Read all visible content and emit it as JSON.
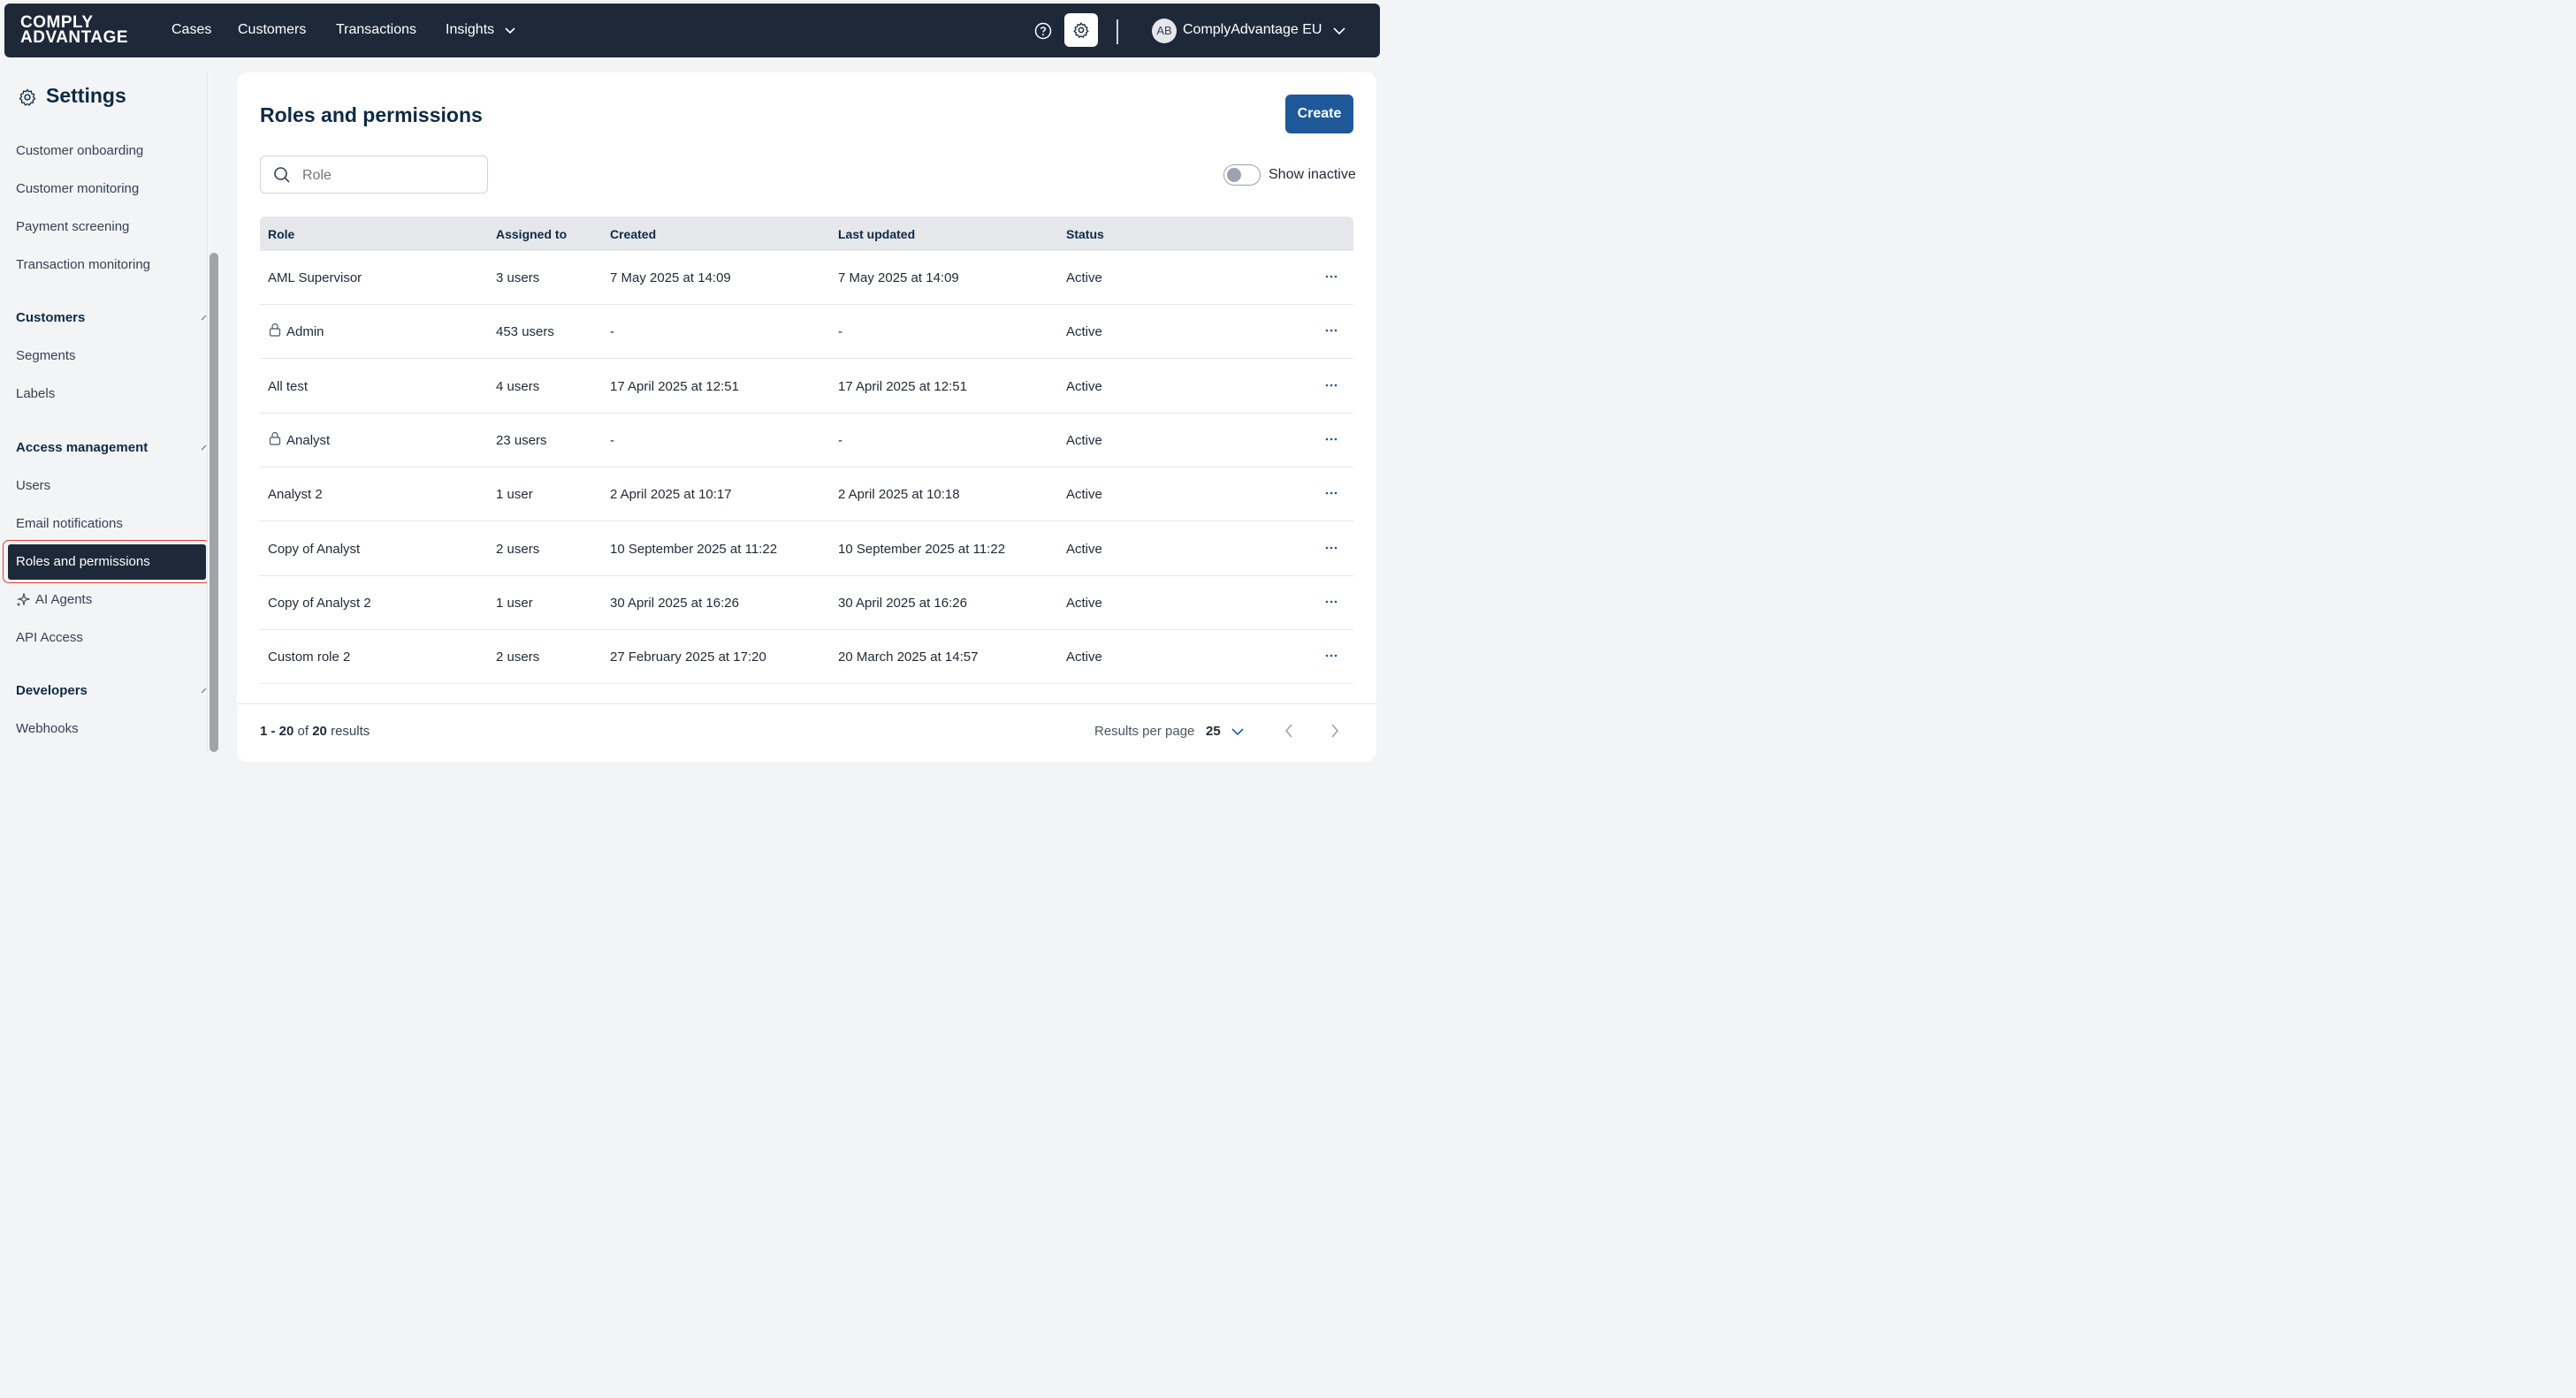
{
  "topbar": {
    "logo_line1": "COMPLY",
    "logo_line2": "ADVANTAGE",
    "nav": [
      "Cases",
      "Customers",
      "Transactions",
      "Insights"
    ],
    "account_initials": "AB",
    "account_name": "ComplyAdvantage EU",
    "icons": [
      "help-icon",
      "gear-icon",
      "chevron-down-icon"
    ]
  },
  "sidebar": {
    "title": "Settings",
    "items_top": [
      "Customer onboarding",
      "Customer monitoring",
      "Payment screening",
      "Transaction monitoring"
    ],
    "customers_heading": "Customers",
    "customers_items": [
      "Segments",
      "Labels"
    ],
    "access_heading": "Access management",
    "access_items": [
      "Users",
      "Email notifications",
      "Roles and permissions",
      "AI Agents",
      "API Access"
    ],
    "developers_heading": "Developers",
    "developers_items": [
      "Webhooks"
    ],
    "active_item": "Roles and permissions"
  },
  "main": {
    "title": "Roles and permissions",
    "create_label": "Create",
    "search_placeholder": "Role",
    "show_inactive_label": "Show inactive",
    "columns": [
      "Role",
      "Assigned to",
      "Created",
      "Last updated",
      "Status"
    ],
    "rows": [
      {
        "role": "AML Supervisor",
        "locked": false,
        "assigned": "3 users",
        "created": "7 May 2025 at 14:09",
        "updated": "7 May 2025 at 14:09",
        "status": "Active"
      },
      {
        "role": "Admin",
        "locked": true,
        "assigned": "453 users",
        "created": "-",
        "updated": "-",
        "status": "Active"
      },
      {
        "role": "All test",
        "locked": false,
        "assigned": "4 users",
        "created": "17 April 2025 at 12:51",
        "updated": "17 April 2025 at 12:51",
        "status": "Active"
      },
      {
        "role": "Analyst",
        "locked": true,
        "assigned": "23 users",
        "created": "-",
        "updated": "-",
        "status": "Active"
      },
      {
        "role": "Analyst 2",
        "locked": false,
        "assigned": "1 user",
        "created": "2 April 2025 at 10:17",
        "updated": "2 April 2025 at 10:18",
        "status": "Active"
      },
      {
        "role": "Copy of Analyst",
        "locked": false,
        "assigned": "2 users",
        "created": "10 September 2025 at 11:22",
        "updated": "10 September 2025 at 11:22",
        "status": "Active"
      },
      {
        "role": "Copy of Analyst 2",
        "locked": false,
        "assigned": "1 user",
        "created": "30 April 2025 at 16:26",
        "updated": "30 April 2025 at 16:26",
        "status": "Active"
      },
      {
        "role": "Custom role 2",
        "locked": false,
        "assigned": "2 users",
        "created": "27 February 2025 at 17:20",
        "updated": "20 March 2025 at 14:57",
        "status": "Active"
      }
    ],
    "footer": {
      "range": "1 - 20",
      "of": "of",
      "total": "20",
      "results_word": "results",
      "rpp_label": "Results per page",
      "rpp_value": "25"
    }
  },
  "colors": {
    "topbar_bg": "#1d2939",
    "primary": "#1f5899",
    "active_outline": "#e53935"
  }
}
